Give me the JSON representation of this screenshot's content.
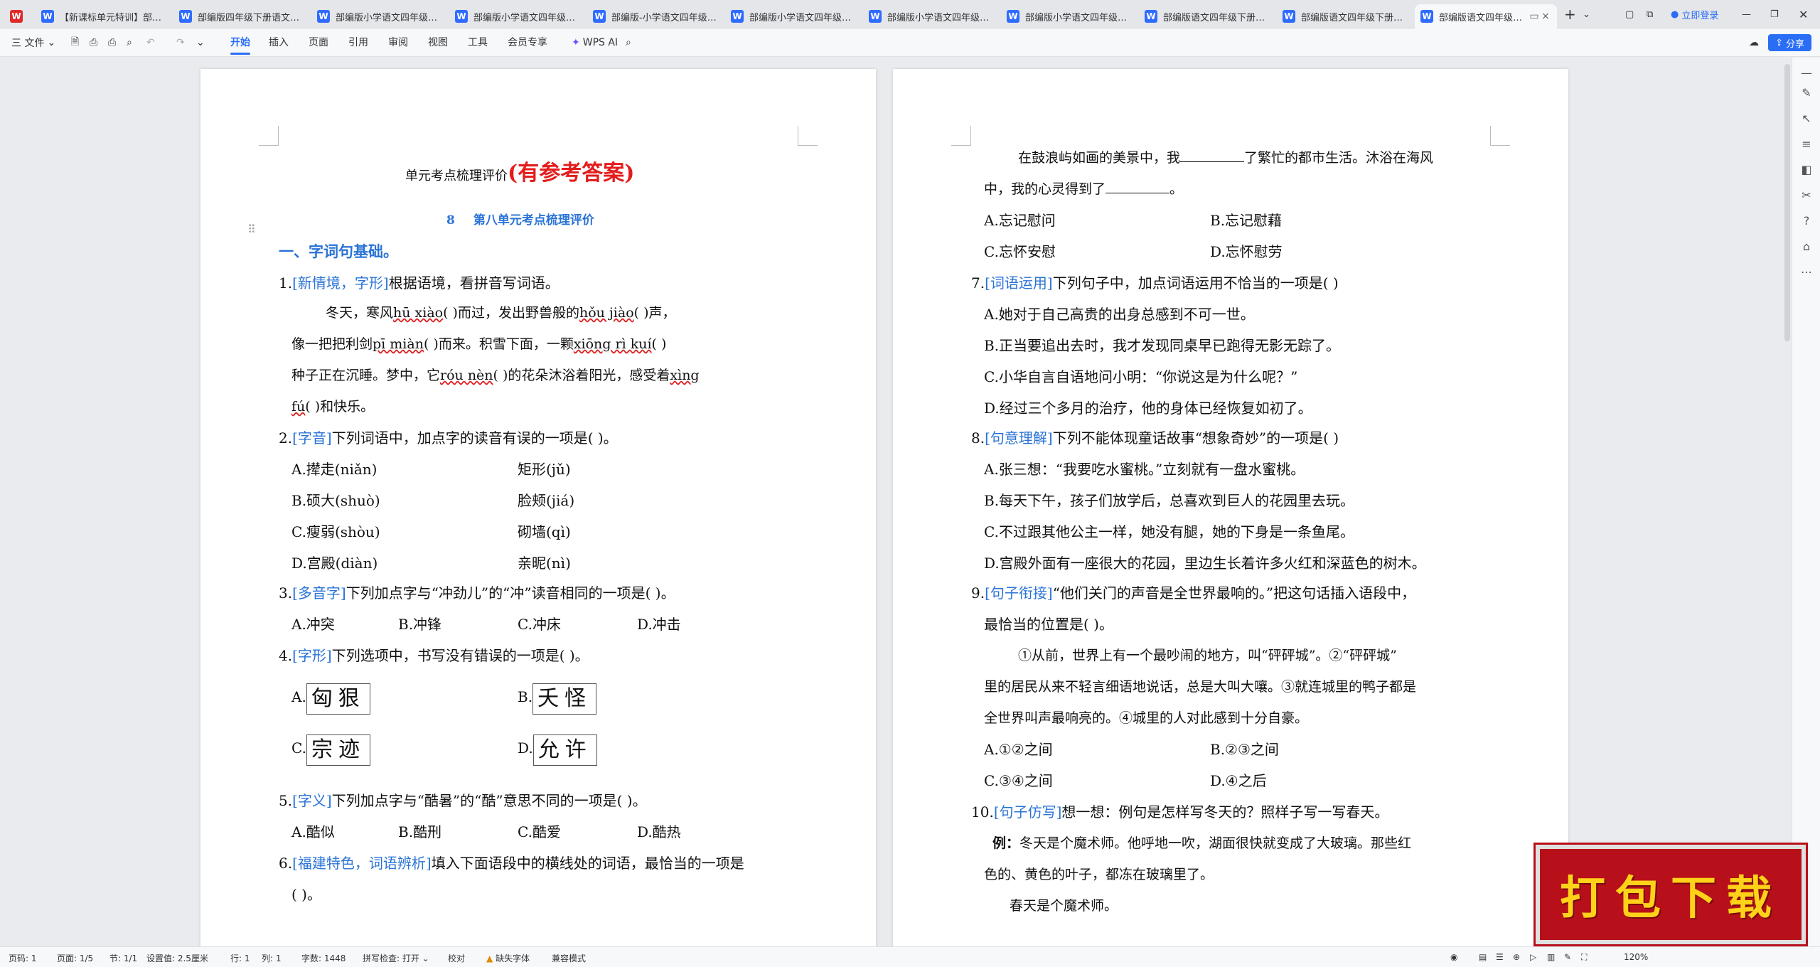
{
  "tabs": [
    {
      "title": "",
      "icon": "wps-logo"
    },
    {
      "title": "【新课标单元特训】部编版"
    },
    {
      "title": "部编版四年级下册语文第八单"
    },
    {
      "title": "部编版小学语文四年级下册"
    },
    {
      "title": "部编版小学语文四年级下册"
    },
    {
      "title": "部编版-小学语文四年级下册"
    },
    {
      "title": "部编版小学语文四年级下册"
    },
    {
      "title": "部编版小学语文四年级下册"
    },
    {
      "title": "部编版小学语文四年级下册"
    },
    {
      "title": "部编版语文四年级下册第八"
    },
    {
      "title": "部编版语文四年级下册第八"
    },
    {
      "title": "部编版语文四年级下册"
    }
  ],
  "login_label": "立即登录",
  "menu": {
    "file": "三 文件",
    "tabs": [
      "开始",
      "插入",
      "页面",
      "引用",
      "审阅",
      "视图",
      "工具",
      "会员专享"
    ],
    "wps_ai": "WPS AI",
    "share": "分享"
  },
  "left_page": {
    "title_main": "单元考点梳理评价",
    "title_red": "(有参考答案)",
    "unit_num": "8",
    "unit_title": "第八单元考点梳理评价",
    "sec1": "一、字词句基础。",
    "q1_num": "1.",
    "q1_tag": "[新情境，字形]",
    "q1_text": "根据语境，看拼音写词语。",
    "q1_p1a": "冬天，寒风",
    "q1_py1": "hū xiào",
    "q1_p1b": "(        )而过，发出野兽般的",
    "q1_py2": "hǒu jiào",
    "q1_p1c": "(        )声，",
    "q1_p2a": "像一把把利剑",
    "q1_py3": "pī miàn",
    "q1_p2b": "(        )而来。积雪下面，一颗",
    "q1_py4": "xiōng rì kuí",
    "q1_p2c": "(            )",
    "q1_p3a": "种子正在沉睡。梦中，它",
    "q1_py5": "róu nèn",
    "q1_p3b": "(        )的花朵沐浴着阳光，感受着",
    "q1_py6": "xìng",
    "q1_p4a": "fú",
    "q1_p4b": "(        )和快乐。",
    "q2_num": "2.",
    "q2_tag": "[字音]",
    "q2_text": "下列词语中，加点字的读音有误的一项是(       )。",
    "q2_opts": [
      "A.撵走(niǎn)",
      "矩形(jǔ)",
      "B.硕大(shuò)",
      "脸颊(jiá)",
      "C.瘦弱(shòu)",
      "砌墙(qì)",
      "D.宫殿(diàn)",
      "亲昵(nì)"
    ],
    "q3_num": "3.",
    "q3_tag": "[多音字]",
    "q3_text": "下列加点字与“冲劲儿”的“冲”读音相同的一项是(       )。",
    "q3_opts": [
      "A.冲突",
      "B.冲锋",
      "C.冲床",
      "D.冲击"
    ],
    "q4_num": "4.",
    "q4_tag": "[字形]",
    "q4_text": "下列选项中，书写没有错误的一项是(       )。",
    "q4_opts": [
      {
        "label": "A.",
        "word": "匈狠"
      },
      {
        "label": "B.",
        "word": "夭怪"
      },
      {
        "label": "C.",
        "word": "宗迹"
      },
      {
        "label": "D.",
        "word": "允许"
      }
    ],
    "q5_num": "5.",
    "q5_tag": "[字义]",
    "q5_text": "下列加点字与“酷暑”的“酷”意思不同的一项是(       )。",
    "q5_opts": [
      "A.酷似",
      "B.酷刑",
      "C.酷爱",
      "D.酷热"
    ],
    "q6_num": "6.",
    "q6_tag": "[福建特色，词语辨析]",
    "q6_text": "填入下面语段中的横线处的词语，最恰当的一项是",
    "q6_text2": "(       )。"
  },
  "right_page": {
    "p1a": "在鼓浪屿如画的美景中，我",
    "p1b": "了繁忙的都市生活。沐浴在海风",
    "p2a": "中，我的心灵得到了",
    "p2b": "。",
    "q6_opts": [
      "A.忘记慰问",
      "B.忘记慰藉",
      "C.忘怀安慰",
      "D.忘怀慰劳"
    ],
    "q7_num": "7.",
    "q7_tag": "[词语运用]",
    "q7_text": "下列句子中，加点词语运用不恰当的一项是(       )",
    "q7_opts": [
      "A.她对于自己高贵的出身总感到不可一世。",
      "B.正当要追出去时，我才发现同桌早已跑得无影无踪了。",
      "C.小华自言自语地问小明：“你说这是为什么呢？”",
      "D.经过三个多月的治疗，他的身体已经恢复如初了。"
    ],
    "q8_num": "8.",
    "q8_tag": "[句意理解]",
    "q8_text": "下列不能体现童话故事“想象奇妙”的一项是(       )",
    "q8_opts": [
      "A.张三想：“我要吃水蜜桃。”立刻就有一盘水蜜桃。",
      "B.每天下午，孩子们放学后，总喜欢到巨人的花园里去玩。",
      "C.不过跟其他公主一样，她没有腿，她的下身是一条鱼尾。",
      "D.宫殿外面有一座很大的花园，里边生长着许多火红和深蓝色的树木。"
    ],
    "q9_num": "9.",
    "q9_tag": "[句子衔接]",
    "q9_text": "“他们关门的声音是全世界最响的。”把这句话插入语段中，",
    "q9_text2": "最恰当的位置是(       )。",
    "q9_p1": "①从前，世界上有一个最吵闹的地方，叫“砰砰城”。②“砰砰城”",
    "q9_p2": "里的居民从来不轻言细语地说话，总是大叫大嚷。③就连城里的鸭子都是",
    "q9_p3": "全世界叫声最响亮的。④城里的人对此感到十分自豪。",
    "q9_opts": [
      "A.①②之间",
      "B.②③之间",
      "C.③④之间",
      "D.④之后"
    ],
    "q10_num": "10.",
    "q10_tag": "[句子仿写]",
    "q10_text": "想一想：例句是怎样写冬天的？照样子写一写春天。",
    "ex_label": "例：",
    "ex_p1": "冬天是个魔术师。他呼地一吹，湖面很快就变成了大玻璃。那些红",
    "ex_p2": "色的、黄色的叶子，都冻在玻璃里了。",
    "spring": "春天是个魔术师。"
  },
  "status": {
    "page": "页码: 1",
    "pages": "页面: 1/5",
    "section": "节: 1/1",
    "setting": "设置值: 2.5厘米",
    "row": "行: 1",
    "col": "列: 1",
    "words": "字数: 1448",
    "spell": "拼写检查: 打开 ⌄",
    "proof": "校对",
    "missing_font": "缺失字体",
    "compat": "兼容模式",
    "zoom": "120%"
  },
  "download_banner": "打包下载"
}
